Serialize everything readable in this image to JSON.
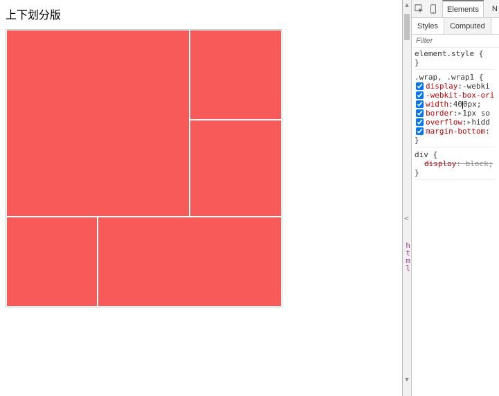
{
  "page": {
    "title": "上下划分版"
  },
  "gutter": {
    "bracket": "<",
    "html_label": "html"
  },
  "devtools": {
    "tabs": {
      "elements": "Elements",
      "next_partial": "N"
    },
    "subtabs": {
      "styles": "Styles",
      "computed": "Computed"
    },
    "filter_placeholder": "Filter",
    "rules": {
      "element_style": "element.style",
      "element_style_body": "",
      "rule1_selector": ".wrap, .wrap1",
      "decls": [
        {
          "prop": "display",
          "val": "-webki",
          "checked": true,
          "tri": false
        },
        {
          "prop": "-webkit-box-ori",
          "val": "",
          "checked": true,
          "tri": false
        },
        {
          "prop": "width",
          "val_pre": "4",
          "val_mid": "0",
          "val_post": "0px;",
          "checked": true,
          "tri": false,
          "editing": true
        },
        {
          "prop": "border",
          "val": "1px so",
          "checked": true,
          "tri": true
        },
        {
          "prop": "overflow",
          "val": "hidd",
          "checked": true,
          "tri": true
        },
        {
          "prop": "margin-bottom",
          "val": "",
          "checked": true,
          "tri": false
        }
      ],
      "rule2_selector": "div",
      "rule2_decl_prop": "display",
      "rule2_decl_val": "block;"
    }
  }
}
